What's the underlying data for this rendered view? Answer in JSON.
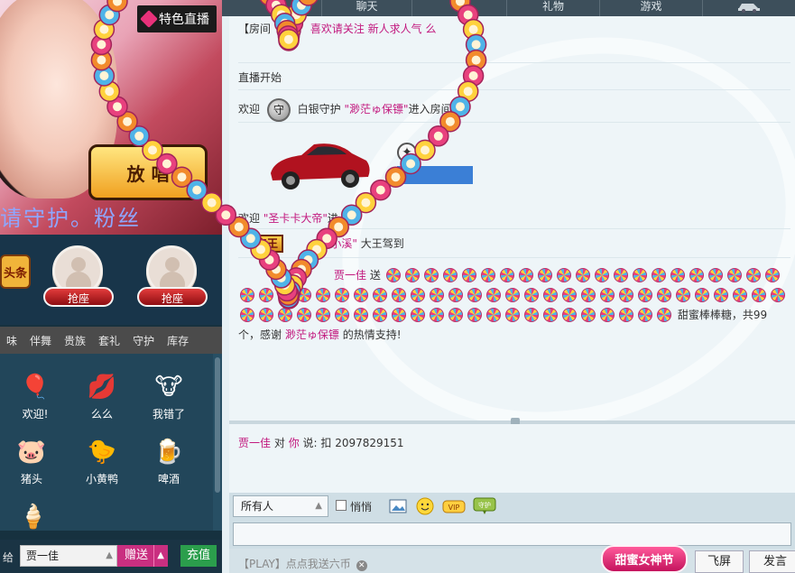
{
  "left": {
    "special_live": "特色直播",
    "marquee": "请守护。粉丝",
    "logo_text": "放 唱",
    "headline_badge": "头条",
    "seats": [
      {
        "label": "抢座"
      },
      {
        "label": "抢座"
      }
    ],
    "gift_tabs": [
      "味",
      "伴舞",
      "贵族",
      "套礼",
      "守护",
      "库存"
    ],
    "gifts": [
      {
        "name": "欢迎!",
        "icon": "balloon-icon",
        "glyph": "🎈"
      },
      {
        "name": "么么",
        "icon": "lips-icon",
        "glyph": "💋"
      },
      {
        "name": "我错了",
        "icon": "cow-icon",
        "glyph": "🐮"
      },
      {
        "name": "猪头",
        "icon": "pig-icon",
        "glyph": "🐷"
      },
      {
        "name": "小黄鸭",
        "icon": "duck-icon",
        "glyph": "🐤"
      },
      {
        "name": "啤酒",
        "icon": "beer-icon",
        "glyph": "🍺"
      },
      {
        "name": "",
        "icon": "icecream-icon",
        "glyph": "🍦"
      }
    ],
    "send": {
      "give_to_label": "给",
      "recipient": "贾一佳",
      "gift_send_label": "赠送",
      "recharge_label": "充值"
    }
  },
  "top_tabs": [
    "聊天",
    "",
    "礼物",
    "游戏"
  ],
  "chat": {
    "notice_prefix": "【房间",
    "notice_pink": "喜欢请关注 新人求人气 么",
    "live_start": "直播开始",
    "welcome1_prefix": "欢迎",
    "guard_icon": "守",
    "welcome1_role": "白银守护",
    "welcome1_user": "\"渺茫ゅ保镖\"",
    "welcome1_suffix": "进入房间",
    "welcome2_prefix": "欢迎",
    "welcome2_user": "\"圣卡卡大帝\"",
    "welcome2_suffix": "进入房",
    "king_badge": "亲王",
    "king_user": "\"◆ 小溪\"",
    "king_suffix": "大王驾到",
    "gift_sender": "贾一佳",
    "gift_verb": "送",
    "lollipop_count": 73,
    "gift_suffix": "甜蜜棒棒糖，共99",
    "thanks_prefix": "个，感谢",
    "thanks_user": "渺茫ゅ保镖",
    "thanks_suffix": "的热情支持!"
  },
  "private": {
    "from": "贾一佳",
    "to_word": "对",
    "to": "你",
    "said": "说:",
    "text": "扣 2097829151"
  },
  "toolbar": {
    "audience": "所有人",
    "whisper_label": "悄悄"
  },
  "bottom": {
    "promo": "【PLAY】点点我送六币",
    "festival": "甜蜜女神节",
    "flyscreen": "飞屏",
    "send": "发言"
  },
  "colors": {
    "pink": "#c2187e",
    "recharge": "#2b9e4c",
    "gift_send": "#c92f80"
  }
}
